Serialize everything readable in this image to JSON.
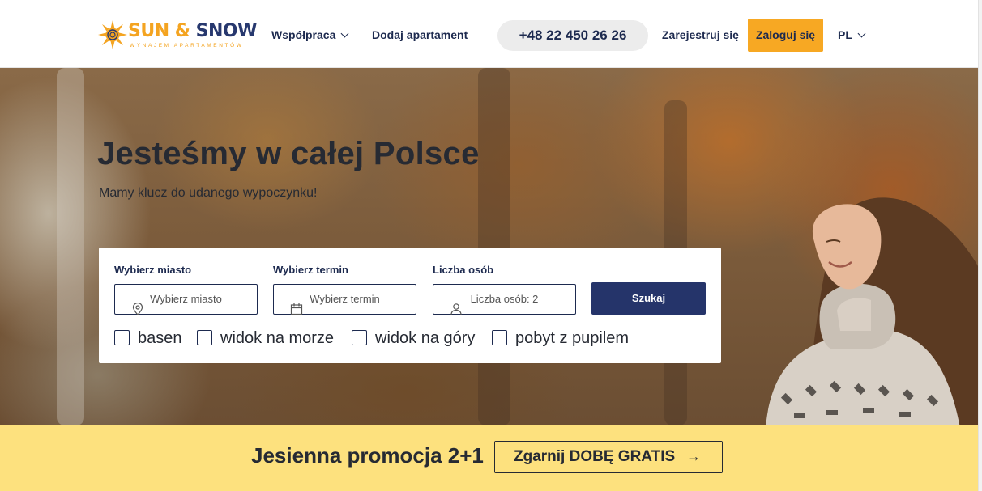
{
  "brand": {
    "name_part1": "SUN",
    "name_amp": "&",
    "name_part2": "SNOW",
    "tagline": "WYNAJEM APARTAMENTÓW"
  },
  "nav": {
    "cooperate": "Współpraca",
    "add_apartment": "Dodaj apartament",
    "phone": "+48 22 450 26 26",
    "register": "Zarejestruj się",
    "login": "Zaloguj się",
    "language": "PL"
  },
  "hero": {
    "title": "Jesteśmy w całej Polsce",
    "subtitle": "Mamy klucz do udanego wypoczynku!"
  },
  "search": {
    "city_label": "Wybierz miasto",
    "city_placeholder": "Wybierz miasto",
    "date_label": "Wybierz termin",
    "date_placeholder": "Wybierz termin",
    "guests_label": "Liczba osób",
    "guests_value": "Liczba osób: 2",
    "submit": "Szukaj",
    "filters": [
      {
        "label": "basen",
        "checked": false
      },
      {
        "label": "widok na morze",
        "checked": false
      },
      {
        "label": "widok na góry",
        "checked": false
      },
      {
        "label": "pobyt z pupilem",
        "checked": false
      }
    ]
  },
  "promo": {
    "text": "Jesienna promocja 2+1",
    "cta": "Zgarnij DOBĘ GRATIS",
    "cta_arrow": "→"
  },
  "colors": {
    "navy": "#25346a",
    "accent_orange": "#f7a823",
    "promo_yellow": "#fde17e"
  }
}
